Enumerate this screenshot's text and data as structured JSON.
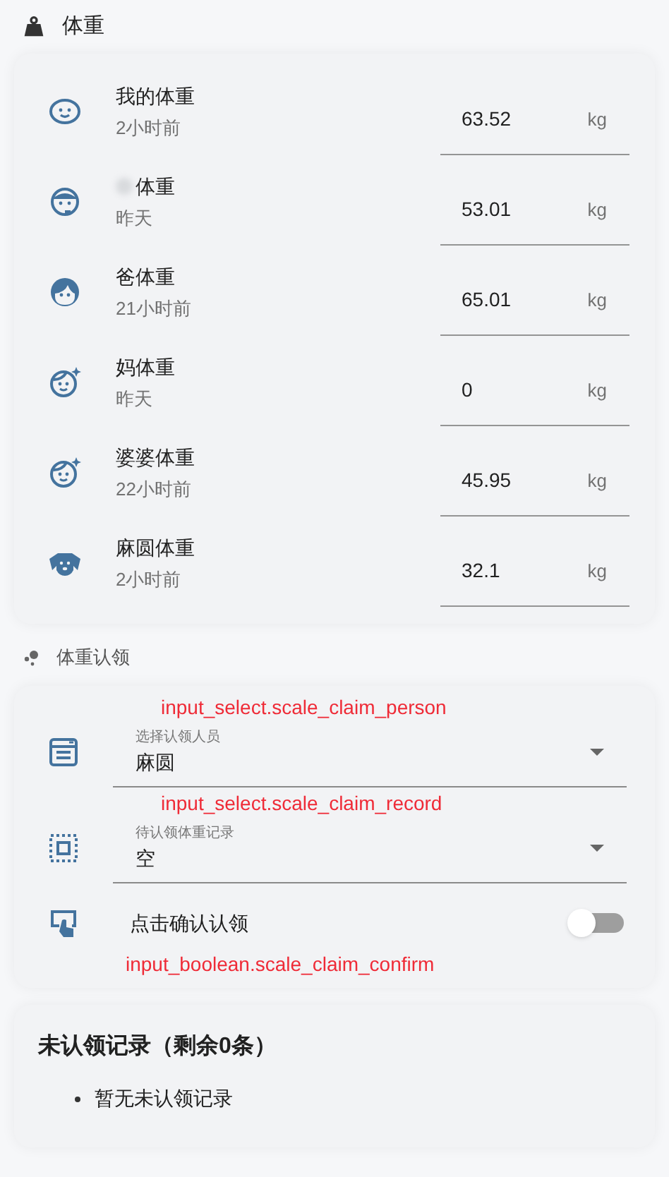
{
  "weight_section": {
    "title": "体重",
    "people": [
      {
        "kind": "baby",
        "name": "我的体重",
        "updated": "2小时前",
        "value": "63.52",
        "unit": "kg",
        "redacted": false
      },
      {
        "kind": "headset",
        "name": "体重",
        "updated": "昨天",
        "value": "53.01",
        "unit": "kg",
        "redacted": true
      },
      {
        "kind": "boy",
        "name": "爸体重",
        "updated": "21小时前",
        "value": "65.01",
        "unit": "kg",
        "redacted": false
      },
      {
        "kind": "sparkle",
        "name": "妈体重",
        "updated": "昨天",
        "value": "0",
        "unit": "kg",
        "redacted": false
      },
      {
        "kind": "sparkle",
        "name": "婆婆体重",
        "updated": "22小时前",
        "value": "45.95",
        "unit": "kg",
        "redacted": false
      },
      {
        "kind": "dog",
        "name": "麻圆体重",
        "updated": "2小时前",
        "value": "32.1",
        "unit": "kg",
        "redacted": false
      }
    ]
  },
  "claim_section": {
    "title": "体重认领",
    "rows": [
      {
        "kind": "select",
        "annotation": "input_select.scale_claim_person",
        "label": "选择认领人员",
        "value": "麻圆"
      },
      {
        "kind": "select",
        "annotation": "input_select.scale_claim_record",
        "label": "待认领体重记录",
        "value": "空"
      },
      {
        "kind": "toggle",
        "label": "点击确认认领",
        "on": false,
        "annotation": "input_boolean.scale_claim_confirm"
      }
    ]
  },
  "unclaimed": {
    "title": "未认领记录（剩余0条）",
    "items": [
      "暂无未认领记录"
    ]
  }
}
